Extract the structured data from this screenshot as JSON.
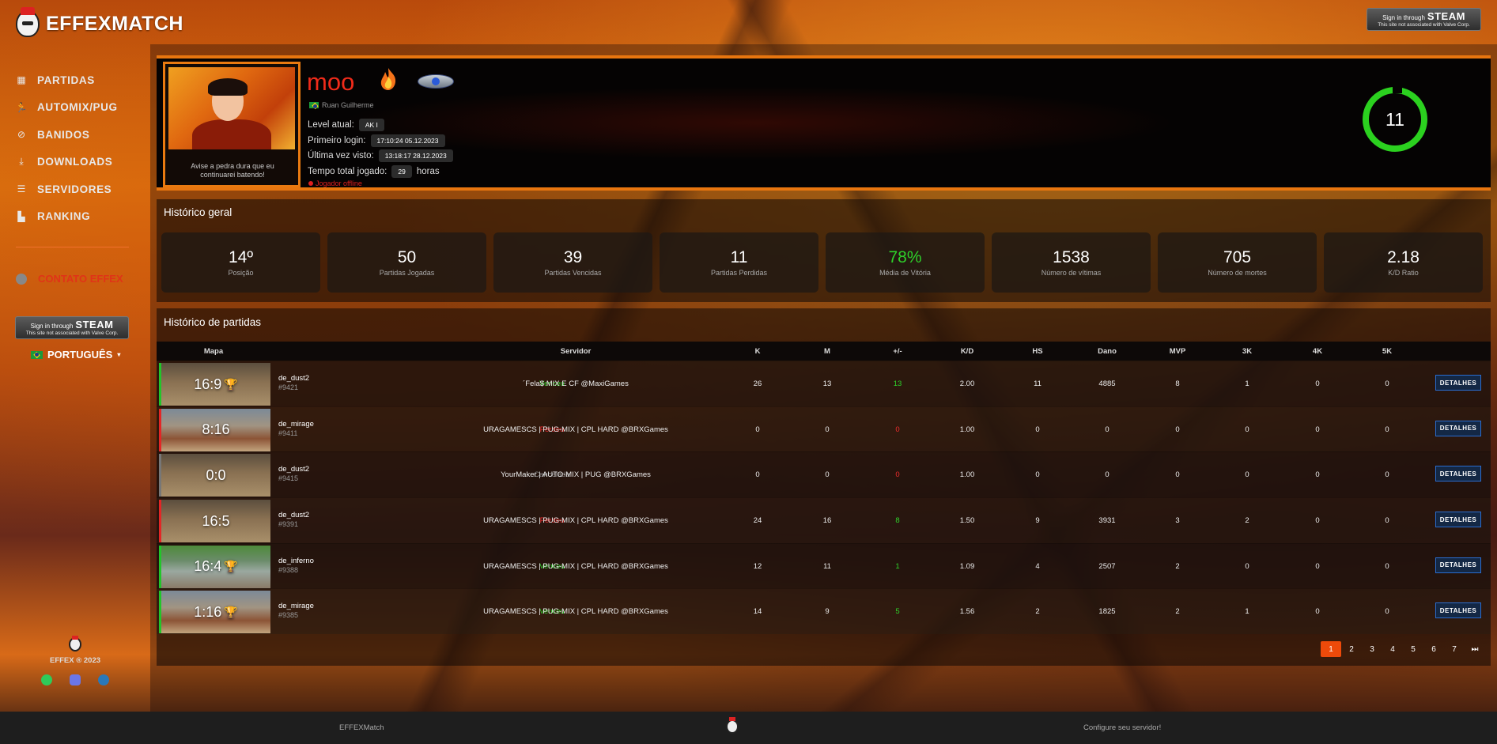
{
  "brand": {
    "name": "EFFEXMATCH"
  },
  "steam_button": {
    "top_label": "Sign in through",
    "brand": "STEAM",
    "disclaimer": "This site not associated with Valve Corp."
  },
  "sidebar": {
    "items": [
      {
        "label": "PARTIDAS",
        "icon": "dashboard-icon"
      },
      {
        "label": "AUTOMIX/PUG",
        "icon": "player-icon"
      },
      {
        "label": "BANIDOS",
        "icon": "ban-icon"
      },
      {
        "label": "DOWNLOADS",
        "icon": "download-icon"
      },
      {
        "label": "SERVIDORES",
        "icon": "server-icon"
      },
      {
        "label": "RANKING",
        "icon": "chart-icon"
      }
    ],
    "contact": "CONTATO EFFEX",
    "language": "PORTUGUÊS",
    "copyright": "EFFEX ® 2023"
  },
  "profile": {
    "nickname": "moo",
    "real_name": "Ruan Guilherme",
    "avatar_caption": "Avise a pedra dura que eu continuarei batendo!",
    "level_label": "Level atual:",
    "level_value": "AK I",
    "first_login_label": "Primeiro login:",
    "first_login_value": "17:10:24 05.12.2023",
    "last_seen_label": "Última vez visto:",
    "last_seen_value": "13:18:17 28.12.2023",
    "playtime_label": "Tempo total jogado:",
    "playtime_value": "29",
    "playtime_unit": "horas",
    "status": "Jogador offline",
    "level_number": "11",
    "status_color": "#e02020",
    "accent_color": "#f02b1a"
  },
  "overview": {
    "title": "Histórico geral",
    "stats": [
      {
        "value": "14º",
        "label": "Posição"
      },
      {
        "value": "50",
        "label": "Partidas Jogadas"
      },
      {
        "value": "39",
        "label": "Partidas Vencidas"
      },
      {
        "value": "11",
        "label": "Partidas Perdidas"
      },
      {
        "value": "78%",
        "label": "Média de Vitória"
      },
      {
        "value": "1538",
        "label": "Número de vítimas"
      },
      {
        "value": "705",
        "label": "Número de mortes"
      },
      {
        "value": "2.18",
        "label": "K/D Ratio"
      }
    ]
  },
  "history": {
    "title": "Histórico de partidas",
    "columns": [
      "Mapa",
      "Servidor",
      "K",
      "M",
      "+/-",
      "K/D",
      "HS",
      "Dano",
      "MVP",
      "3K",
      "4K",
      "5K"
    ],
    "detail_label": "DETALHES",
    "rows": [
      {
        "score": "16:9",
        "trophy": true,
        "map": "de_dust2",
        "id": "#9421",
        "result": "Venceu",
        "server": "´Fela$ MIX E CF @MaxiGames",
        "k": "26",
        "m": "13",
        "pm": "13",
        "kd": "2.00",
        "hs": "11",
        "dano": "4885",
        "mvp": "8",
        "k3": "1",
        "k4": "0",
        "k5": "0"
      },
      {
        "score": "8:16",
        "trophy": false,
        "map": "de_mirage",
        "id": "#9411",
        "result": "Perdeu",
        "server": "URAGAMESCS | PUG-MIX | CPL HARD @BRXGames",
        "k": "0",
        "m": "0",
        "pm": "0",
        "kd": "1.00",
        "hs": "0",
        "dano": "0",
        "mvp": "0",
        "k3": "0",
        "k4": "0",
        "k5": "0"
      },
      {
        "score": "0:0",
        "trophy": false,
        "map": "de_dust2",
        "id": "#9415",
        "result": "Cancelada",
        "server": "YourMaker | AUTO-MIX | PUG @BRXGames",
        "k": "0",
        "m": "0",
        "pm": "0",
        "kd": "1.00",
        "hs": "0",
        "dano": "0",
        "mvp": "0",
        "k3": "0",
        "k4": "0",
        "k5": "0"
      },
      {
        "score": "16:5",
        "trophy": false,
        "map": "de_dust2",
        "id": "#9391",
        "result": "Perdeu",
        "server": "URAGAMESCS | PUG-MIX | CPL HARD @BRXGames",
        "k": "24",
        "m": "16",
        "pm": "8",
        "kd": "1.50",
        "hs": "9",
        "dano": "3931",
        "mvp": "3",
        "k3": "2",
        "k4": "0",
        "k5": "0"
      },
      {
        "score": "16:4",
        "trophy": true,
        "map": "de_inferno",
        "id": "#9388",
        "result": "Venceu",
        "server": "URAGAMESCS | PUG-MIX | CPL HARD @BRXGames",
        "k": "12",
        "m": "11",
        "pm": "1",
        "kd": "1.09",
        "hs": "4",
        "dano": "2507",
        "mvp": "2",
        "k3": "0",
        "k4": "0",
        "k5": "0"
      },
      {
        "score": "1:16",
        "trophy": true,
        "map": "de_mirage",
        "id": "#9385",
        "result": "Venceu",
        "server": "URAGAMESCS | PUG-MIX | CPL HARD @BRXGames",
        "k": "14",
        "m": "9",
        "pm": "5",
        "kd": "1.56",
        "hs": "2",
        "dano": "1825",
        "mvp": "2",
        "k3": "1",
        "k4": "0",
        "k5": "0"
      }
    ],
    "pages": [
      "1",
      "2",
      "3",
      "4",
      "5",
      "6",
      "7"
    ],
    "last_page_icon": "⏭"
  },
  "footer": {
    "left": "EFFEXMatch",
    "right": "Configure seu servidor!"
  }
}
